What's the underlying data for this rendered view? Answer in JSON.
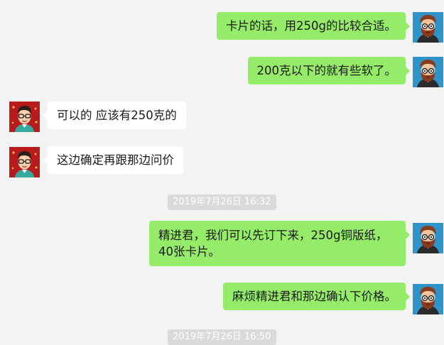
{
  "messages": [
    {
      "from": "me",
      "text": "卡片的话，用250g的比较合适。"
    },
    {
      "from": "me",
      "text": "200克以下的就有些软了。"
    },
    {
      "from": "other",
      "text": "可以的  应该有250克的"
    },
    {
      "from": "other",
      "text": "这边确定再跟那边问价"
    },
    {
      "from": "me",
      "text": "精进君，我们可以先订下来，250g铜版纸，40张卡片。"
    },
    {
      "from": "me",
      "text": "麻烦精进君和那边确认下价格。"
    }
  ],
  "timestamps": [
    "2019年7月26日 16:32",
    "2019年7月26日 16:50"
  ],
  "colors": {
    "background": "#f3f3f3",
    "my_bubble": "#95ec69",
    "other_bubble": "#ffffff",
    "timestamp_bg": "#dadada"
  },
  "icons": {
    "my_avatar": "bearded-man-glasses-avatar-icon",
    "other_avatar": "man-glasses-red-background-avatar-icon"
  }
}
